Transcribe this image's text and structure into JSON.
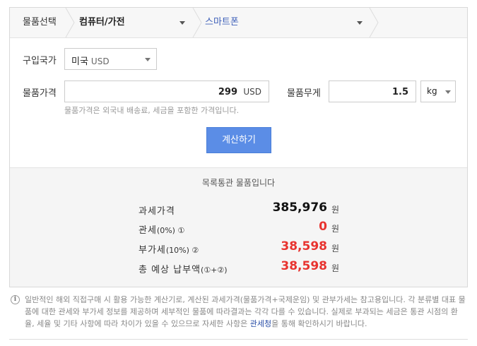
{
  "breadcrumb": {
    "item1": "물품선택",
    "item2": "컴퓨터/가전",
    "item3": "스마트폰"
  },
  "form": {
    "country_label": "구입국가",
    "country_value": "미국",
    "country_currency": "USD",
    "price_label": "물품가격",
    "price_value": "299",
    "price_unit": "USD",
    "price_hint": "물품가격은 외국내 배송료, 세금을 포함한 가격입니다.",
    "weight_label": "물품무게",
    "weight_value": "1.5",
    "weight_unit": "kg",
    "calc_button": "계산하기"
  },
  "result": {
    "title": "목록통관 물품입니다",
    "rows": [
      {
        "label": "과세가격",
        "sub": "",
        "value": "385,976",
        "unit": "원",
        "color": "#111111"
      },
      {
        "label": "관세",
        "sub": "(0%) ①",
        "value": "0",
        "unit": "원",
        "color": "#e8332f"
      },
      {
        "label": "부가세",
        "sub": "(10%) ②",
        "value": "38,598",
        "unit": "원",
        "color": "#e8332f"
      },
      {
        "label": "총 예상 납부액",
        "sub": "(①+②)",
        "value": "38,598",
        "unit": "원",
        "color": "#e8332f"
      }
    ]
  },
  "note": {
    "icon": "info-icon",
    "text_before": "일반적인 해외 직접구매 시 활용 가능한 계산기로, 계산된 과세가격(물품가격+국제운임) 및 관부가세는 참고용입니다. 각 분류별 대표 물품에 대한 관세와 부가세 정보를 제공하며 세부적인 물품에 따라결과는 각각 다를 수 있습니다. 실제로 부과되는 세금은 통관 시점의 환율, 세율 및 기타 사항에 따라 차이가 있을 수 있으므로 자세한 사항은 ",
    "link": "관세청",
    "text_after": "을 통해 확인하시기 바랍니다."
  }
}
